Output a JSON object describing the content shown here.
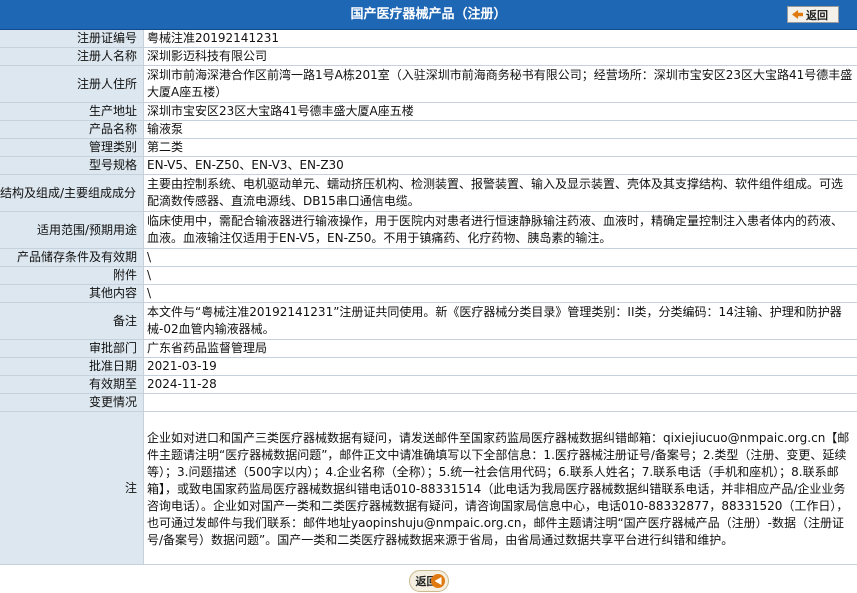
{
  "header": {
    "title": "国产医疗器械产品（注册）",
    "back_label": "返回"
  },
  "fields": {
    "reg_no": {
      "label": "注册证编号",
      "value": "粤械注准20192141231"
    },
    "registrant": {
      "label": "注册人名称",
      "value": "深圳影迈科技有限公司"
    },
    "address": {
      "label": "注册人住所",
      "value": "深圳市前海深港合作区前湾一路1号A栋201室（入驻深圳市前海商务秘书有限公司；经营场所：深圳市宝安区23区大宝路41号德丰盛大厦A座五楼）"
    },
    "production": {
      "label": "生产地址",
      "value": "深圳市宝安区23区大宝路41号德丰盛大厦A座五楼"
    },
    "product": {
      "label": "产品名称",
      "value": "输液泵"
    },
    "category": {
      "label": "管理类别",
      "value": "第二类"
    },
    "model": {
      "label": "型号规格",
      "value": "EN-V5、EN-Z50、EN-V3、EN-Z30"
    },
    "structure": {
      "label": "结构及组成/主要组成成分",
      "value": "主要由控制系统、电机驱动单元、蠕动挤压机构、检测装置、报警装置、输入及显示装置、壳体及其支撑结构、软件组件组成。可选配滴数传感器、直流电源线、DB15串口通信电缆。"
    },
    "scope": {
      "label": "适用范围/预期用途",
      "value": "临床使用中，需配合输液器进行输液操作，用于医院内对患者进行恒速静脉输注药液、血液时，精确定量控制注入患者体内的药液、血液。血液输注仅适用于EN-V5，EN-Z50。不用于镇痛药、化疗药物、胰岛素的输注。"
    },
    "storage": {
      "label": "产品储存条件及有效期",
      "value": "\\"
    },
    "attachment": {
      "label": "附件",
      "value": "\\"
    },
    "other": {
      "label": "其他内容",
      "value": "\\"
    },
    "remark": {
      "label": "备注",
      "value": "本文件与“粤械注准20192141231”注册证共同使用。新《医疗器械分类目录》管理类别：II类，分类编码：14注输、护理和防护器械-02血管内输液器械。"
    },
    "dept": {
      "label": "审批部门",
      "value": "广东省药品监督管理局"
    },
    "approval_date": {
      "label": "批准日期",
      "value": "2021-03-19"
    },
    "valid_until": {
      "label": "有效期至",
      "value": "2024-11-28"
    },
    "changes": {
      "label": "变更情况",
      "value": ""
    },
    "note": {
      "label": "注",
      "value": "企业如对进口和国产三类医疗器械数据有疑问，请发送邮件至国家药监局医疗器械数据纠错邮箱：qixiejiucuo@nmpaic.org.cn【邮件主题请注明“医疗器械数据问题”，邮件正文中请准确填写以下全部信息：1.医疗器械注册证号/备案号；2.类型（注册、变更、延续等）；3.问题描述（500字以内）；4.企业名称（全称）；5.统一社会信用代码；6.联系人姓名；7.联系电话（手机和座机）；8.联系邮箱】，或致电国家药监局医疗器械数据纠错电话010-88331514（此电话为我局医疗器械数据纠错联系电话，并非相应产品/企业业务咨询电话）。企业如对国产一类和二类医疗器械数据有疑问，请咨询国家局信息中心，电话010-88332877，88331520（工作日），也可通过发邮件与我们联系：邮件地址yaopinshuju@nmpaic.org.cn，邮件主题请注明“国产医疗器械产品（注册）-数据（注册证号/备案号）数据问题”。国产一类和二类医疗器械数据来源于省局，由省局通过数据共享平台进行纠错和维护。"
    }
  }
}
